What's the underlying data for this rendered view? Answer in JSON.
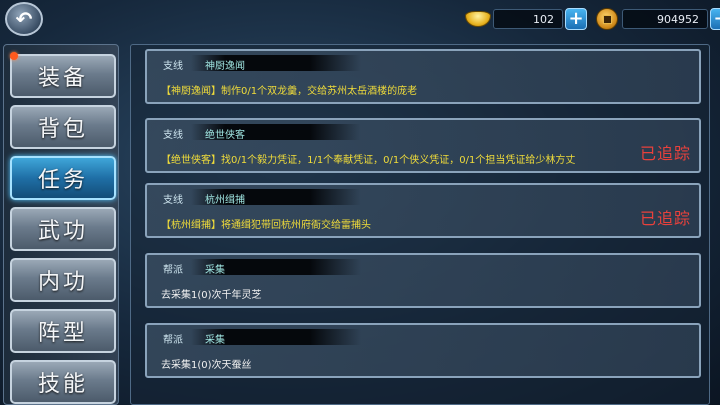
{
  "currencies": [
    {
      "icon": "gold-ingot-icon",
      "value": "102"
    },
    {
      "icon": "copper-coin-icon",
      "value": "904952"
    }
  ],
  "sidebar": {
    "tabs": [
      {
        "label": "装备"
      },
      {
        "label": "背包"
      },
      {
        "label": "任务"
      },
      {
        "label": "武功"
      },
      {
        "label": "内功"
      },
      {
        "label": "阵型"
      },
      {
        "label": "技能"
      }
    ],
    "active_tab": "任务"
  },
  "quests": [
    {
      "type": "支线",
      "name": "神厨逸闻",
      "desc": "【神厨逸闻】制作0/1个双龙羹，交给苏州太岳酒楼的庞老",
      "tracked": ""
    },
    {
      "type": "支线",
      "name": "绝世侠客",
      "desc": "【绝世侠客】找0/1个毅力凭证，1/1个奉献凭证，0/1个侠义凭证，0/1个担当凭证给少林方丈",
      "tracked": "已追踪"
    },
    {
      "type": "支线",
      "name": "杭州缉捕",
      "desc": "【杭州缉捕】将通缉犯带回杭州府衙交给雷捕头",
      "tracked": "已追踪"
    },
    {
      "type": "帮派",
      "name": "采集",
      "desc": "去采集1(0)次千年灵芝",
      "tracked": ""
    },
    {
      "type": "帮派",
      "name": "采集",
      "desc": "去采集1(0)次天蚕丝",
      "tracked": ""
    }
  ],
  "colors": {
    "tracked": "#e8413c",
    "quest_desc": "#f0dc3a",
    "active_tab": "#1f6fa6"
  }
}
